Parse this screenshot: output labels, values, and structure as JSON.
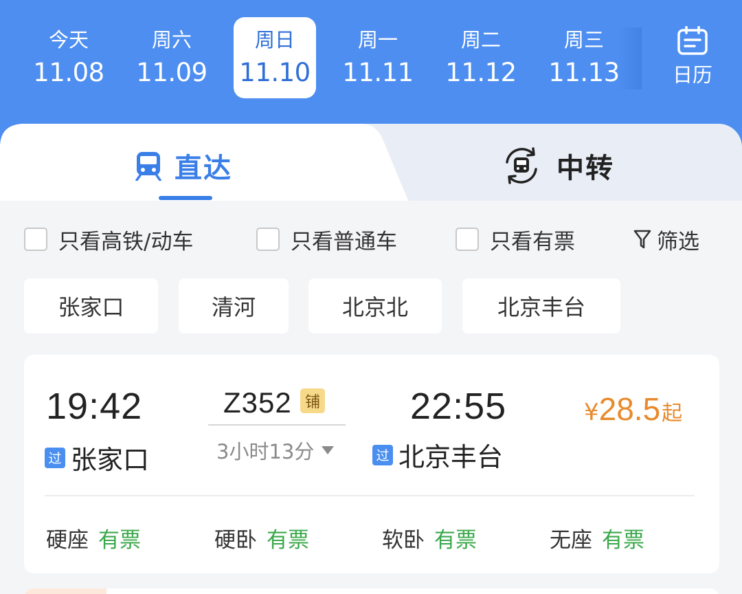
{
  "dates": [
    {
      "weekday": "今天",
      "date": "11.08"
    },
    {
      "weekday": "周六",
      "date": "11.09"
    },
    {
      "weekday": "周日",
      "date": "11.10"
    },
    {
      "weekday": "周一",
      "date": "11.11"
    },
    {
      "weekday": "周二",
      "date": "11.12"
    },
    {
      "weekday": "周三",
      "date": "11.13"
    }
  ],
  "selected_date_index": 2,
  "calendar_label": "日历",
  "tabs": {
    "direct": "直达",
    "transfer": "中转"
  },
  "filters": {
    "high_speed_only": "只看高铁/动车",
    "normal_only": "只看普通车",
    "available_only": "只看有票",
    "sift": "筛选"
  },
  "stations": [
    "张家口",
    "清河",
    "北京北",
    "北京丰台"
  ],
  "train": {
    "depart_time": "19:42",
    "depart_station": "张家口",
    "depart_badge": "过",
    "train_number": "Z352",
    "train_badge": "铺",
    "duration": "3小时13分",
    "arrive_time": "22:55",
    "arrive_station": "北京丰台",
    "arrive_badge": "过",
    "price_currency": "¥",
    "price": "28.5",
    "price_suffix": "起",
    "seats": [
      {
        "type": "硬座",
        "status": "有票"
      },
      {
        "type": "硬卧",
        "status": "有票"
      },
      {
        "type": "软卧",
        "status": "有票"
      },
      {
        "type": "无座",
        "status": "有票"
      }
    ]
  },
  "colors": {
    "header_blue": "#4d8ef0",
    "accent_blue": "#3a7ee8",
    "price_orange": "#e88a2c",
    "available_green": "#3aa84a"
  }
}
